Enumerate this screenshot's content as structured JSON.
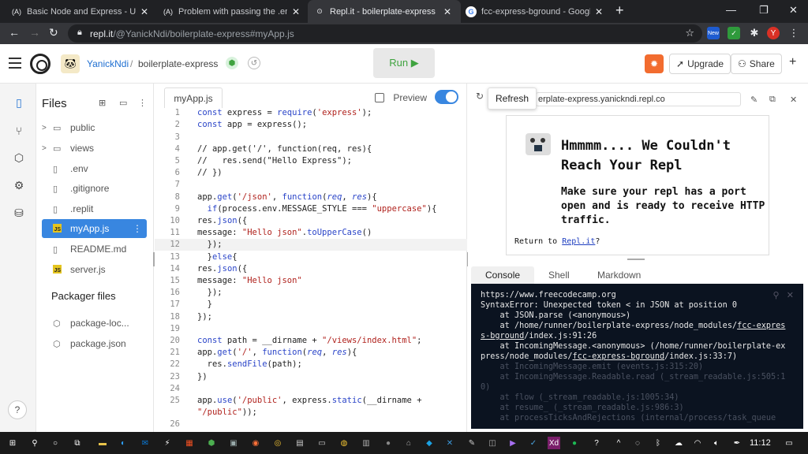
{
  "browser": {
    "tabs": [
      {
        "icon": "(A)",
        "title": "Basic Node and Express - Use the"
      },
      {
        "icon": "(A)",
        "title": "Problem with passing the .env e"
      },
      {
        "icon": "⊙",
        "title": "Repl.it - boilerplate-express"
      },
      {
        "icon": "G",
        "title": "fcc-express-bground - Google Se"
      }
    ],
    "url_host": "repl.it",
    "url_path": "/@YanickNdi/boilerplate-express#myApp.js",
    "profile_initial": "Y",
    "ext_badge": "New"
  },
  "header": {
    "user": "YanickNdi",
    "separator": "/",
    "repl_name": "boilerplate-express",
    "run_label": "Run ▶",
    "upgrade_label": "Upgrade",
    "share_label": "Share"
  },
  "files": {
    "title": "Files",
    "items": [
      {
        "name": "public",
        "type": "folder"
      },
      {
        "name": "views",
        "type": "folder"
      },
      {
        "name": ".env",
        "type": "file"
      },
      {
        "name": ".gitignore",
        "type": "file"
      },
      {
        "name": ".replit",
        "type": "file"
      },
      {
        "name": "myApp.js",
        "type": "js",
        "selected": true
      },
      {
        "name": "README.md",
        "type": "file"
      },
      {
        "name": "server.js",
        "type": "js"
      }
    ],
    "packager_title": "Packager files",
    "packager_items": [
      "package-loc...",
      "package.json"
    ]
  },
  "editor": {
    "tab": "myApp.js",
    "preview_label": "Preview",
    "current_line": 12
  },
  "webview": {
    "refresh_tooltip": "Refresh",
    "url": "erplate-express.yanickndi.repl.co",
    "heading": "Hmmmm.... We Couldn't Reach Your Repl",
    "message": "Make sure your repl has a port open and is ready to receive HTTP traffic.",
    "return_prefix": "Return to ",
    "return_link": "Repl.it",
    "return_suffix": "?"
  },
  "console": {
    "tabs": [
      "Console",
      "Shell",
      "Markdown"
    ]
  },
  "taskbar": {
    "time": "11:12"
  },
  "colors": {
    "accent": "#3886e0",
    "run_green": "#3fa33f",
    "console_bg": "#0b1320",
    "bug_orange": "#f26c2f"
  }
}
